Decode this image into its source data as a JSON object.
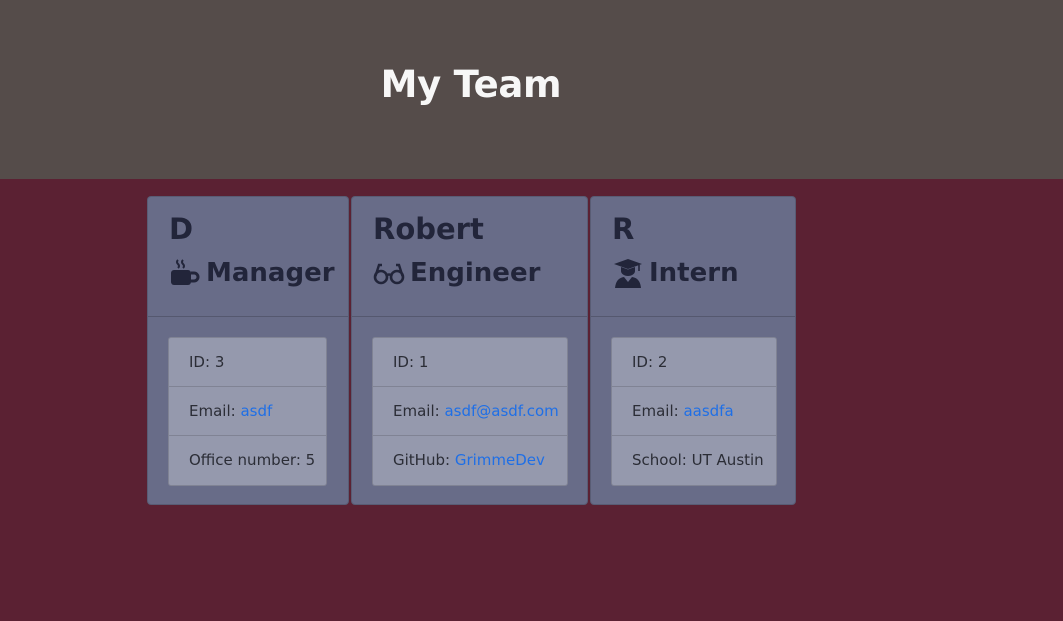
{
  "header": {
    "title": "My Team"
  },
  "colors": {
    "header_bg": "#554c4a",
    "page_bg": "#5b2133",
    "card_bg": "#686c88",
    "list_bg": "#9599ad",
    "link": "#1f6fe6"
  },
  "cards": [
    {
      "name": "D",
      "role": "Manager",
      "icon": "coffee-mug-icon",
      "id_label": "ID:",
      "id_value": "3",
      "email_label": "Email:",
      "email_value": "asdf",
      "extra_label": "Office number:",
      "extra_value": "5"
    },
    {
      "name": "Robert",
      "role": "Engineer",
      "icon": "glasses-icon",
      "id_label": "ID:",
      "id_value": "1",
      "email_label": "Email:",
      "email_value": "asdf@asdf.com",
      "extra_label": "GitHub:",
      "extra_value": "GrimmeDev"
    },
    {
      "name": "R",
      "role": "Intern",
      "icon": "graduate-icon",
      "id_label": "ID:",
      "id_value": "2",
      "email_label": "Email:",
      "email_value": "aasdfa",
      "extra_label": "School:",
      "extra_value": "UT Austin"
    }
  ]
}
